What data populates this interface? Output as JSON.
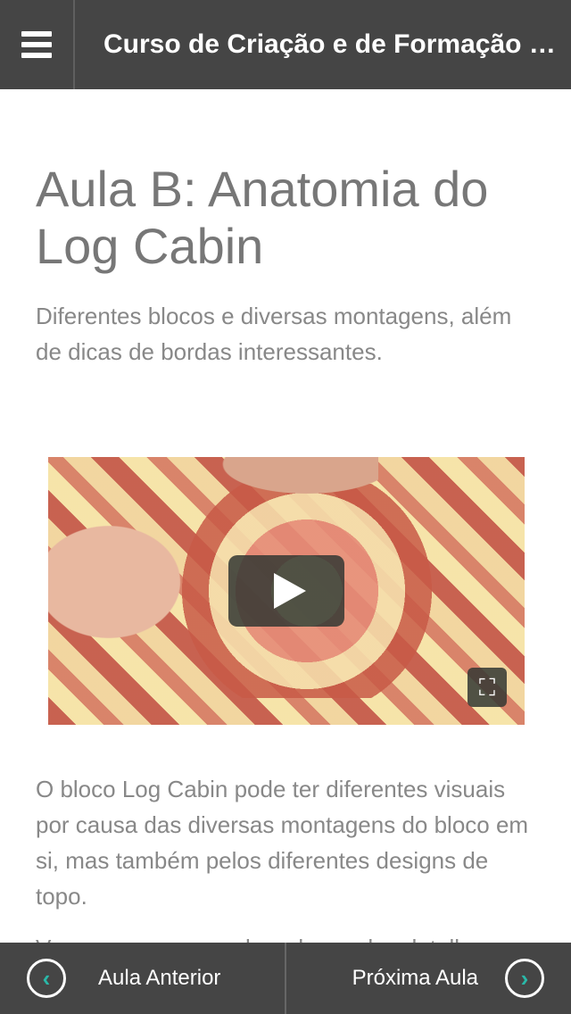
{
  "header": {
    "title": "Curso de Criação e de Formação de Log Cabin",
    "menu_icon": "hamburger-menu-icon"
  },
  "lesson": {
    "title": "Aula B: Anatomia do Log Cabin",
    "subtitle": "Diferentes blocos e diversas montagens, além de dicas de bordas interessantes.",
    "video": {
      "play_icon": "play-icon",
      "fullscreen_icon": "fullscreen-icon",
      "fullscreen_glyph": "⛶"
    },
    "paragraphs": [
      "O bloco Log Cabin pode ter diferentes visuais por causa das diversas montagens do bloco em si, mas também pelos diferentes designs de topo.",
      "Vamos conversar sobre alguns dos detalhes"
    ]
  },
  "footer": {
    "prev_label": "Aula Anterior",
    "prev_glyph": "‹",
    "next_label": "Próxima Aula",
    "next_glyph": "›",
    "accent_color": "#2ab8a8"
  }
}
